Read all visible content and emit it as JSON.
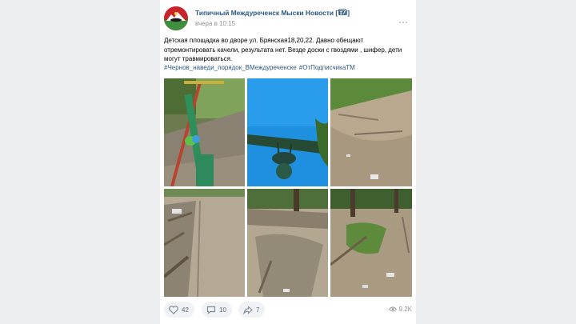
{
  "post": {
    "group_name": "Типичный Междуреченск Мыски Новости [ТМ]",
    "time": "вчера в 10:15",
    "text": "Детская площадка во дворе ул. Брянская18,20,22. Давно обещают отремонтировать качели, результата нет. Везде доски с гвоздями , шифер, дети могут травмироваться.",
    "hashtags": [
      "#Чернов_наведи_порядок_ВМеждуреченске",
      "#ОтПодписчикаТМ"
    ]
  },
  "icons": {
    "avatar": "group-logo-avatar",
    "official": "official-page-icon",
    "more": "more-options-icon",
    "like": "heart-icon",
    "comment": "comment-bubble-icon",
    "share": "share-arrow-icon",
    "views": "eye-icon"
  },
  "photos": [
    {
      "name": "photo-swing-frame"
    },
    {
      "name": "photo-swing-seat-sky"
    },
    {
      "name": "photo-ground-debris"
    },
    {
      "name": "photo-boards-path"
    },
    {
      "name": "photo-tree-shadow"
    },
    {
      "name": "photo-grass-debris"
    }
  ],
  "stats": {
    "likes": "42",
    "comments": "10",
    "shares": "7",
    "views": "9.2K"
  },
  "colors": {
    "link": "#2a5885",
    "background": "#edeef0",
    "avatar_red": "#c8242c"
  }
}
